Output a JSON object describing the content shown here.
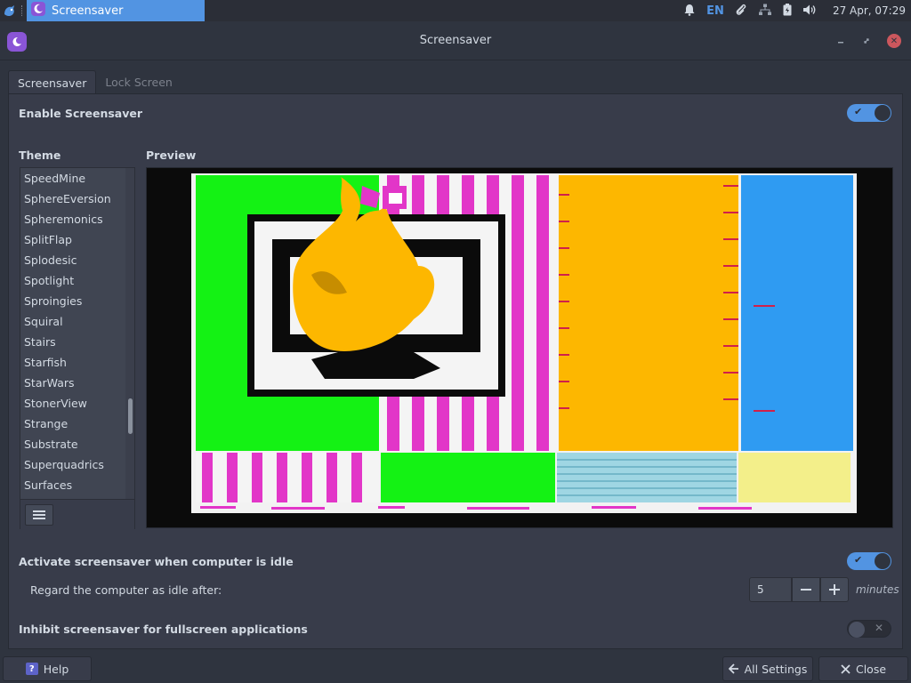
{
  "panel": {
    "task_label": "Screensaver",
    "language": "EN",
    "clock": "27 Apr, 07:29"
  },
  "window": {
    "title": "Screensaver"
  },
  "tabs": [
    {
      "label": "Screensaver",
      "active": true
    },
    {
      "label": "Lock Screen",
      "active": false
    }
  ],
  "enable": {
    "label": "Enable Screensaver",
    "on": true
  },
  "theme": {
    "heading": "Theme",
    "items": [
      "SpeedMine",
      "SphereEversion",
      "Spheremonics",
      "SplitFlap",
      "Splodesic",
      "Spotlight",
      "Sproingies",
      "Squiral",
      "Stairs",
      "Starfish",
      "StarWars",
      "StonerView",
      "Strange",
      "Substrate",
      "Superquadrics",
      "Surfaces"
    ],
    "scroll_position": 0.78
  },
  "preview": {
    "heading": "Preview"
  },
  "idle": {
    "label": "Activate screensaver when computer is idle",
    "on": true,
    "regard_label": "Regard the computer as idle after:",
    "value": "5",
    "units": "minutes"
  },
  "inhibit": {
    "label": "Inhibit screensaver for fullscreen applications",
    "on": false
  },
  "buttons": {
    "help": "Help",
    "all_settings": "All Settings",
    "close": "Close"
  },
  "colors": {
    "accent": "#5294e2",
    "close_red": "#cc575d",
    "app_icon": "#8a55d6"
  }
}
